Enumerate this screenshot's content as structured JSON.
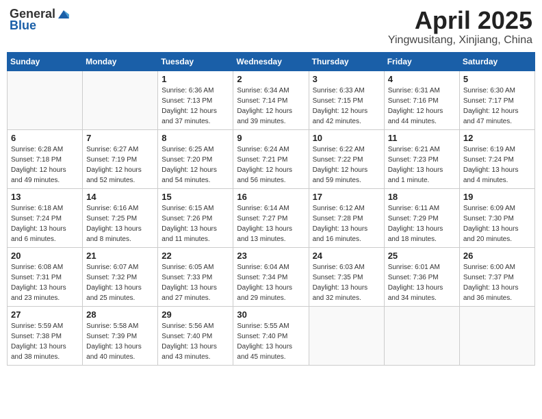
{
  "logo": {
    "general": "General",
    "blue": "Blue"
  },
  "title": "April 2025",
  "location": "Yingwusitang, Xinjiang, China",
  "days_of_week": [
    "Sunday",
    "Monday",
    "Tuesday",
    "Wednesday",
    "Thursday",
    "Friday",
    "Saturday"
  ],
  "weeks": [
    [
      {
        "day": "",
        "info": ""
      },
      {
        "day": "",
        "info": ""
      },
      {
        "day": "1",
        "info": "Sunrise: 6:36 AM\nSunset: 7:13 PM\nDaylight: 12 hours\nand 37 minutes."
      },
      {
        "day": "2",
        "info": "Sunrise: 6:34 AM\nSunset: 7:14 PM\nDaylight: 12 hours\nand 39 minutes."
      },
      {
        "day": "3",
        "info": "Sunrise: 6:33 AM\nSunset: 7:15 PM\nDaylight: 12 hours\nand 42 minutes."
      },
      {
        "day": "4",
        "info": "Sunrise: 6:31 AM\nSunset: 7:16 PM\nDaylight: 12 hours\nand 44 minutes."
      },
      {
        "day": "5",
        "info": "Sunrise: 6:30 AM\nSunset: 7:17 PM\nDaylight: 12 hours\nand 47 minutes."
      }
    ],
    [
      {
        "day": "6",
        "info": "Sunrise: 6:28 AM\nSunset: 7:18 PM\nDaylight: 12 hours\nand 49 minutes."
      },
      {
        "day": "7",
        "info": "Sunrise: 6:27 AM\nSunset: 7:19 PM\nDaylight: 12 hours\nand 52 minutes."
      },
      {
        "day": "8",
        "info": "Sunrise: 6:25 AM\nSunset: 7:20 PM\nDaylight: 12 hours\nand 54 minutes."
      },
      {
        "day": "9",
        "info": "Sunrise: 6:24 AM\nSunset: 7:21 PM\nDaylight: 12 hours\nand 56 minutes."
      },
      {
        "day": "10",
        "info": "Sunrise: 6:22 AM\nSunset: 7:22 PM\nDaylight: 12 hours\nand 59 minutes."
      },
      {
        "day": "11",
        "info": "Sunrise: 6:21 AM\nSunset: 7:23 PM\nDaylight: 13 hours\nand 1 minute."
      },
      {
        "day": "12",
        "info": "Sunrise: 6:19 AM\nSunset: 7:24 PM\nDaylight: 13 hours\nand 4 minutes."
      }
    ],
    [
      {
        "day": "13",
        "info": "Sunrise: 6:18 AM\nSunset: 7:24 PM\nDaylight: 13 hours\nand 6 minutes."
      },
      {
        "day": "14",
        "info": "Sunrise: 6:16 AM\nSunset: 7:25 PM\nDaylight: 13 hours\nand 8 minutes."
      },
      {
        "day": "15",
        "info": "Sunrise: 6:15 AM\nSunset: 7:26 PM\nDaylight: 13 hours\nand 11 minutes."
      },
      {
        "day": "16",
        "info": "Sunrise: 6:14 AM\nSunset: 7:27 PM\nDaylight: 13 hours\nand 13 minutes."
      },
      {
        "day": "17",
        "info": "Sunrise: 6:12 AM\nSunset: 7:28 PM\nDaylight: 13 hours\nand 16 minutes."
      },
      {
        "day": "18",
        "info": "Sunrise: 6:11 AM\nSunset: 7:29 PM\nDaylight: 13 hours\nand 18 minutes."
      },
      {
        "day": "19",
        "info": "Sunrise: 6:09 AM\nSunset: 7:30 PM\nDaylight: 13 hours\nand 20 minutes."
      }
    ],
    [
      {
        "day": "20",
        "info": "Sunrise: 6:08 AM\nSunset: 7:31 PM\nDaylight: 13 hours\nand 23 minutes."
      },
      {
        "day": "21",
        "info": "Sunrise: 6:07 AM\nSunset: 7:32 PM\nDaylight: 13 hours\nand 25 minutes."
      },
      {
        "day": "22",
        "info": "Sunrise: 6:05 AM\nSunset: 7:33 PM\nDaylight: 13 hours\nand 27 minutes."
      },
      {
        "day": "23",
        "info": "Sunrise: 6:04 AM\nSunset: 7:34 PM\nDaylight: 13 hours\nand 29 minutes."
      },
      {
        "day": "24",
        "info": "Sunrise: 6:03 AM\nSunset: 7:35 PM\nDaylight: 13 hours\nand 32 minutes."
      },
      {
        "day": "25",
        "info": "Sunrise: 6:01 AM\nSunset: 7:36 PM\nDaylight: 13 hours\nand 34 minutes."
      },
      {
        "day": "26",
        "info": "Sunrise: 6:00 AM\nSunset: 7:37 PM\nDaylight: 13 hours\nand 36 minutes."
      }
    ],
    [
      {
        "day": "27",
        "info": "Sunrise: 5:59 AM\nSunset: 7:38 PM\nDaylight: 13 hours\nand 38 minutes."
      },
      {
        "day": "28",
        "info": "Sunrise: 5:58 AM\nSunset: 7:39 PM\nDaylight: 13 hours\nand 40 minutes."
      },
      {
        "day": "29",
        "info": "Sunrise: 5:56 AM\nSunset: 7:40 PM\nDaylight: 13 hours\nand 43 minutes."
      },
      {
        "day": "30",
        "info": "Sunrise: 5:55 AM\nSunset: 7:40 PM\nDaylight: 13 hours\nand 45 minutes."
      },
      {
        "day": "",
        "info": ""
      },
      {
        "day": "",
        "info": ""
      },
      {
        "day": "",
        "info": ""
      }
    ]
  ]
}
